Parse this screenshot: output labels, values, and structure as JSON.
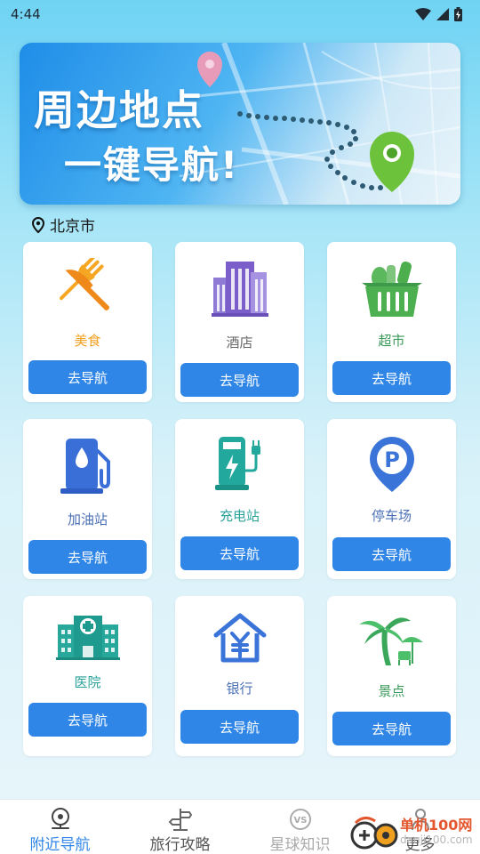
{
  "status_bar": {
    "time": "4:44"
  },
  "banner": {
    "line1": "周边地点",
    "line2": "一键导航!"
  },
  "location": {
    "city": "北京市"
  },
  "categories": [
    {
      "label": "美食",
      "button": "去导航",
      "label_color": "#f0a020",
      "icon": "fork-knife-icon"
    },
    {
      "label": "酒店",
      "button": "去导航",
      "label_color": "#666666",
      "icon": "hotel-building-icon"
    },
    {
      "label": "超市",
      "button": "去导航",
      "label_color": "#3a9a5a",
      "icon": "shopping-basket-icon"
    },
    {
      "label": "加油站",
      "button": "去导航",
      "label_color": "#4a6fb5",
      "icon": "gas-pump-icon"
    },
    {
      "label": "充电站",
      "button": "去导航",
      "label_color": "#2aa39a",
      "icon": "charging-station-icon"
    },
    {
      "label": "停车场",
      "button": "去导航",
      "label_color": "#4a6fb5",
      "icon": "parking-pin-icon"
    },
    {
      "label": "医院",
      "button": "去导航",
      "label_color": "#2aa39a",
      "icon": "hospital-icon"
    },
    {
      "label": "银行",
      "button": "去导航",
      "label_color": "#4a6fb5",
      "icon": "bank-icon"
    },
    {
      "label": "景点",
      "button": "去导航",
      "label_color": "#3a9a5a",
      "icon": "palm-tree-icon"
    }
  ],
  "tabs": [
    {
      "label": "附近导航",
      "icon": "nearby-nav-icon"
    },
    {
      "label": "旅行攻略",
      "icon": "signpost-icon"
    },
    {
      "label": "星球知识",
      "icon": "vs-icon"
    },
    {
      "label": "更多",
      "icon": "person-icon"
    }
  ],
  "watermark": {
    "brand": "单机100网",
    "domain": "danji100.com"
  },
  "colors": {
    "accent": "#2f86e6",
    "tab_active": "#2f86e6"
  }
}
